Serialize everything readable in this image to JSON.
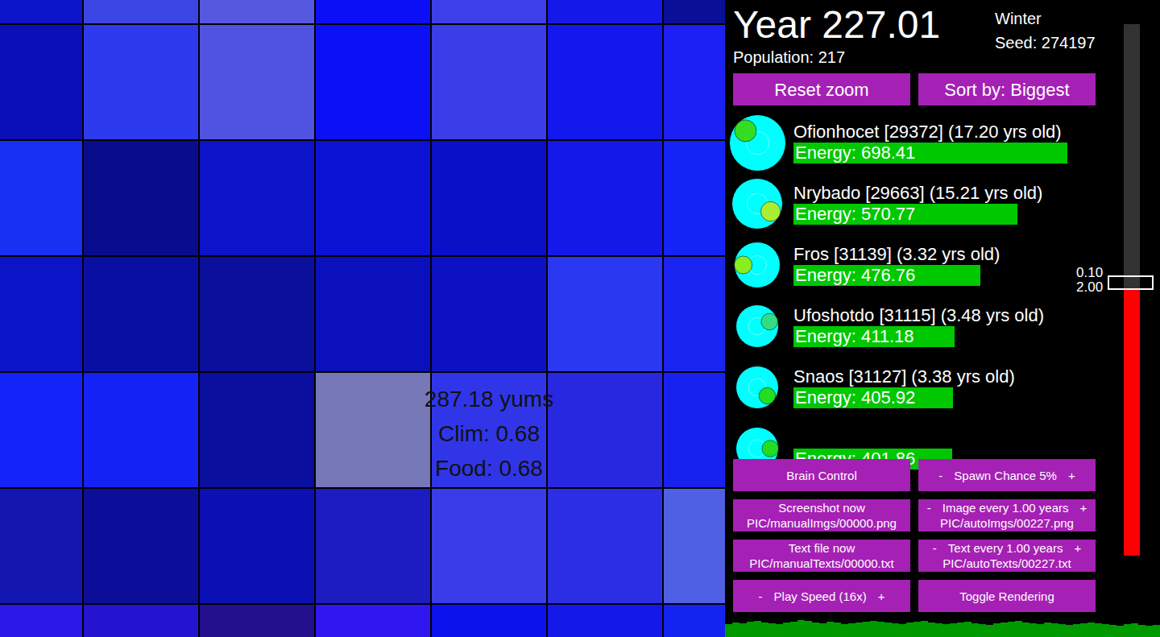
{
  "map": {
    "tiles": [
      [
        "#0c14c8",
        "#3c46e4",
        "#5658e0",
        "#0b0ff5",
        "#3d3fe8",
        "#1418e8",
        "#0a0f98"
      ],
      [
        "#0b0fb8",
        "#2e3aee",
        "#5052e2",
        "#0c10f4",
        "#3b3de8",
        "#1218ee",
        "#1c20f2"
      ],
      [
        "#1630f4",
        "#0a0c8e",
        "#0c13c8",
        "#0b12d4",
        "#0a0fc8",
        "#1418e8",
        "#1424f6"
      ],
      [
        "#0c14c8",
        "#0a0fa4",
        "#0a0f9c",
        "#0a10bc",
        "#0c12c4",
        "#2a38f2",
        "#1a24f0"
      ],
      [
        "#1424f8",
        "#1422f6",
        "#0a0f9e",
        "#7778b8",
        "#3036e8",
        "#2828e0",
        "#1822f0"
      ],
      [
        "#1416b0",
        "#0c0e9a",
        "#0c10b4",
        "#1c1cc0",
        "#3a3cea",
        "#2c2ee6",
        "#5060e4"
      ],
      [
        "#2c18e8",
        "#2414d0",
        "#22108c",
        "#3016f0",
        "#0c12ec",
        "#1418e8",
        "#1424f0"
      ]
    ],
    "tile_info": [
      "287.18 yums",
      "Clim: 0.68",
      "Food: 0.68"
    ]
  },
  "header": {
    "year": "Year 227.01",
    "population": "Population: 217",
    "season": "Winter",
    "seed": "Seed: 274197"
  },
  "top_buttons": [
    "Reset zoom",
    "Sort by: Biggest"
  ],
  "creatures": [
    {
      "name": "Ofionhocet [29372] (17.20 yrs old)",
      "energy_text": "Energy: 698.41",
      "level": 0.486,
      "mouth_angle": 135,
      "mouth_color": "#33dd22"
    },
    {
      "name": "Nrybado [29663] (15.21 yrs old)",
      "energy_text": "Energy: 570.77",
      "level": 0.397,
      "mouth_angle": -30,
      "mouth_color": "#aaee33"
    },
    {
      "name": "Fros [31139] (3.32 yrs old)",
      "energy_text": "Energy: 476.76",
      "level": 0.331,
      "mouth_angle": 180,
      "mouth_color": "#88ee22"
    },
    {
      "name": "Ufoshotdo [31115] (3.48 yrs old)",
      "energy_text": "Energy: 411.18",
      "level": 0.286,
      "mouth_angle": 20,
      "mouth_color": "#33dd88"
    },
    {
      "name": "Snaos [31127] (3.38 yrs old)",
      "energy_text": "Energy: 405.92",
      "level": 0.283,
      "mouth_angle": -40,
      "mouth_color": "#22dd22"
    },
    {
      "name": "",
      "energy_text": "Energy: 401.86",
      "level": 0.281,
      "mouth_angle": 0,
      "mouth_color": "#22dd22"
    }
  ],
  "controls": [
    {
      "label": "Brain Control",
      "minus": "",
      "plus": "",
      "path": ""
    },
    {
      "label": "Spawn Chance 5%",
      "minus": "-",
      "plus": "+",
      "path": ""
    },
    {
      "label": "Screenshot now",
      "minus": "",
      "plus": "",
      "path": "PIC/manualImgs/00000.png"
    },
    {
      "label": "Image every 1.00 years",
      "minus": "-",
      "plus": "+",
      "path": "PIC/autoImgs/00227.png"
    },
    {
      "label": "Text file now",
      "minus": "",
      "plus": "",
      "path": "PIC/manualTexts/00000.txt"
    },
    {
      "label": "Text every 1.00 years",
      "minus": "-",
      "plus": "+",
      "path": "PIC/autoTexts/00227.txt"
    },
    {
      "label": "Play Speed (16x)",
      "minus": "-",
      "plus": "+",
      "path": ""
    },
    {
      "label": "Toggle Rendering",
      "minus": "",
      "plus": "",
      "path": ""
    }
  ],
  "slider": {
    "level": 0.5,
    "labels": [
      "0.10",
      "2.00"
    ]
  },
  "population_graph": [
    16,
    18,
    17,
    19,
    20,
    18,
    17,
    16,
    18,
    19,
    21,
    20,
    18,
    17,
    19,
    18,
    16,
    17,
    18,
    19,
    20,
    19,
    18,
    17,
    16,
    18,
    19,
    20,
    18,
    17,
    16,
    17,
    18,
    19,
    17,
    16,
    15,
    17,
    18,
    19,
    20,
    18,
    17,
    16,
    18,
    17,
    16,
    15,
    16,
    17,
    18,
    17,
    16,
    15,
    14,
    16,
    17,
    15,
    14,
    15
  ]
}
